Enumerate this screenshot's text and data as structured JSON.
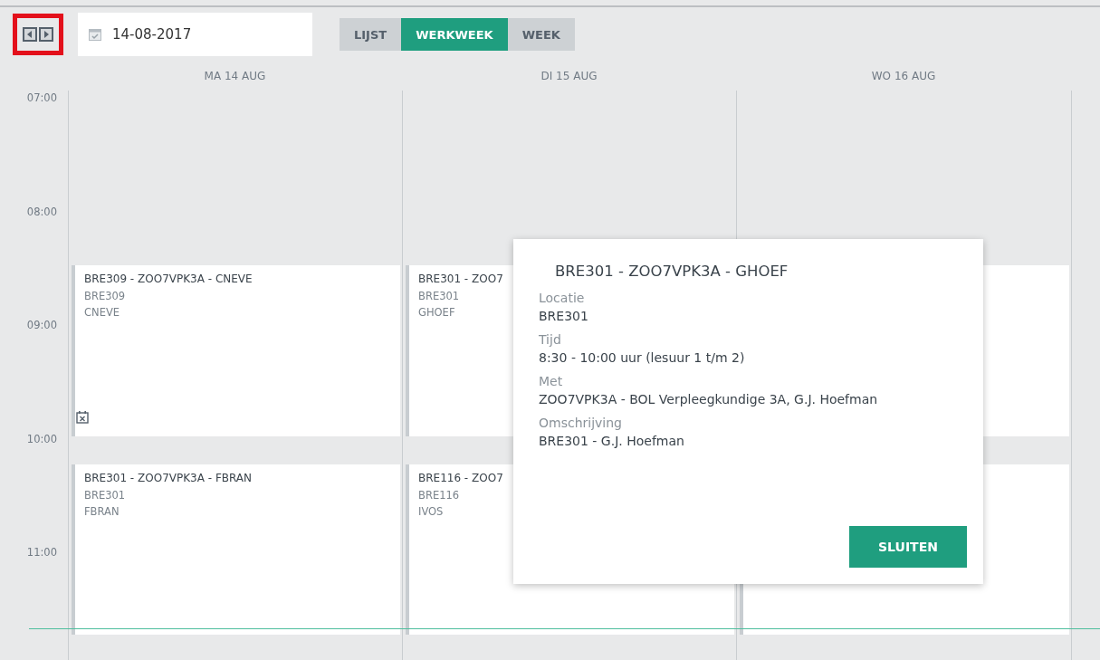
{
  "toolbar": {
    "highlighted_nav": true,
    "date_field": {
      "value": "14-08-2017"
    },
    "view_tabs": [
      {
        "label": "LIJST",
        "selected": false
      },
      {
        "label": "WERKWEEK",
        "selected": true
      },
      {
        "label": "WEEK",
        "selected": false
      }
    ]
  },
  "calendar": {
    "hours": [
      "07:00",
      "08:00",
      "09:00",
      "10:00",
      "11:00"
    ],
    "days": [
      {
        "header": "MA 14 AUG",
        "events": [
          {
            "kind": "lesson",
            "title": "BRE309 - ZOO7VPK3A - CNEVE",
            "lines": [
              "BRE309",
              "CNEVE"
            ],
            "flagged": true
          },
          {
            "kind": "lesson",
            "title": "BRE301 - ZOO7VPK3A - FBRAN",
            "lines": [
              "BRE301",
              "FBRAN"
            ],
            "flagged": false
          }
        ]
      },
      {
        "header": "DI 15 AUG",
        "events": [
          {
            "kind": "lesson",
            "title": "BRE301 - ZOO7",
            "lines": [
              "BRE301",
              "GHOEF"
            ],
            "flagged": false
          },
          {
            "kind": "lesson",
            "title": "BRE116 - ZOO7",
            "lines": [
              "BRE116",
              "IVOS"
            ],
            "flagged": false
          }
        ]
      },
      {
        "header": "WO 16 AUG",
        "events": [
          {
            "kind": "lesson",
            "flagged": false
          },
          {
            "kind": "lesson",
            "flagged": false
          }
        ]
      }
    ]
  },
  "popup": {
    "title": "BRE301 - ZOO7VPK3A - GHOEF",
    "fields": [
      {
        "label": "Locatie",
        "value": "BRE301"
      },
      {
        "label": "Tijd",
        "value": "8:30 - 10:00 uur (lesuur 1 t/m 2)"
      },
      {
        "label": "Met",
        "value": "ZOO7VPK3A - BOL Verpleegkundige 3A, G.J. Hoefman"
      },
      {
        "label": "Omschrijving",
        "value": "BRE301 - G.J. Hoefman"
      }
    ],
    "button": "SLUITEN"
  }
}
